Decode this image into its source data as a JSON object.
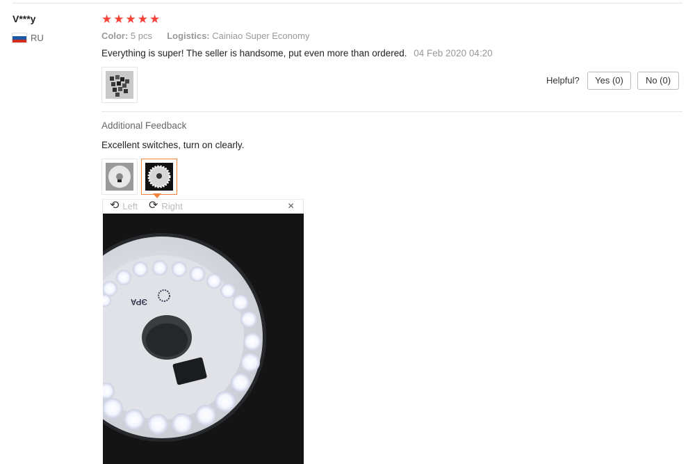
{
  "review": {
    "user": "V***y",
    "country": "RU",
    "rating": 5,
    "star_glyph": "★",
    "color_label": "Color:",
    "color_value": "5 pcs",
    "logistics_label": "Logistics:",
    "logistics_value": "Cainiao Super Economy",
    "text": "Everything is super! The seller is handsome, put even more than ordered.",
    "date": "04 Feb 2020 04:20"
  },
  "helpful": {
    "label": "Helpful?",
    "yes": "Yes (0)",
    "no": "No (0)"
  },
  "additional": {
    "title": "Additional Feedback",
    "text": "Excellent switches, turn on clearly."
  },
  "viewer": {
    "rotate_left": "Left",
    "rotate_right": "Right",
    "close_glyph": "×",
    "rotate_left_icon": "rotate-ccw-icon",
    "rotate_right_icon": "rotate-cw-icon",
    "light_text": "ЭРА"
  },
  "colors": {
    "star": "#f44336",
    "accent": "#f0823c"
  }
}
